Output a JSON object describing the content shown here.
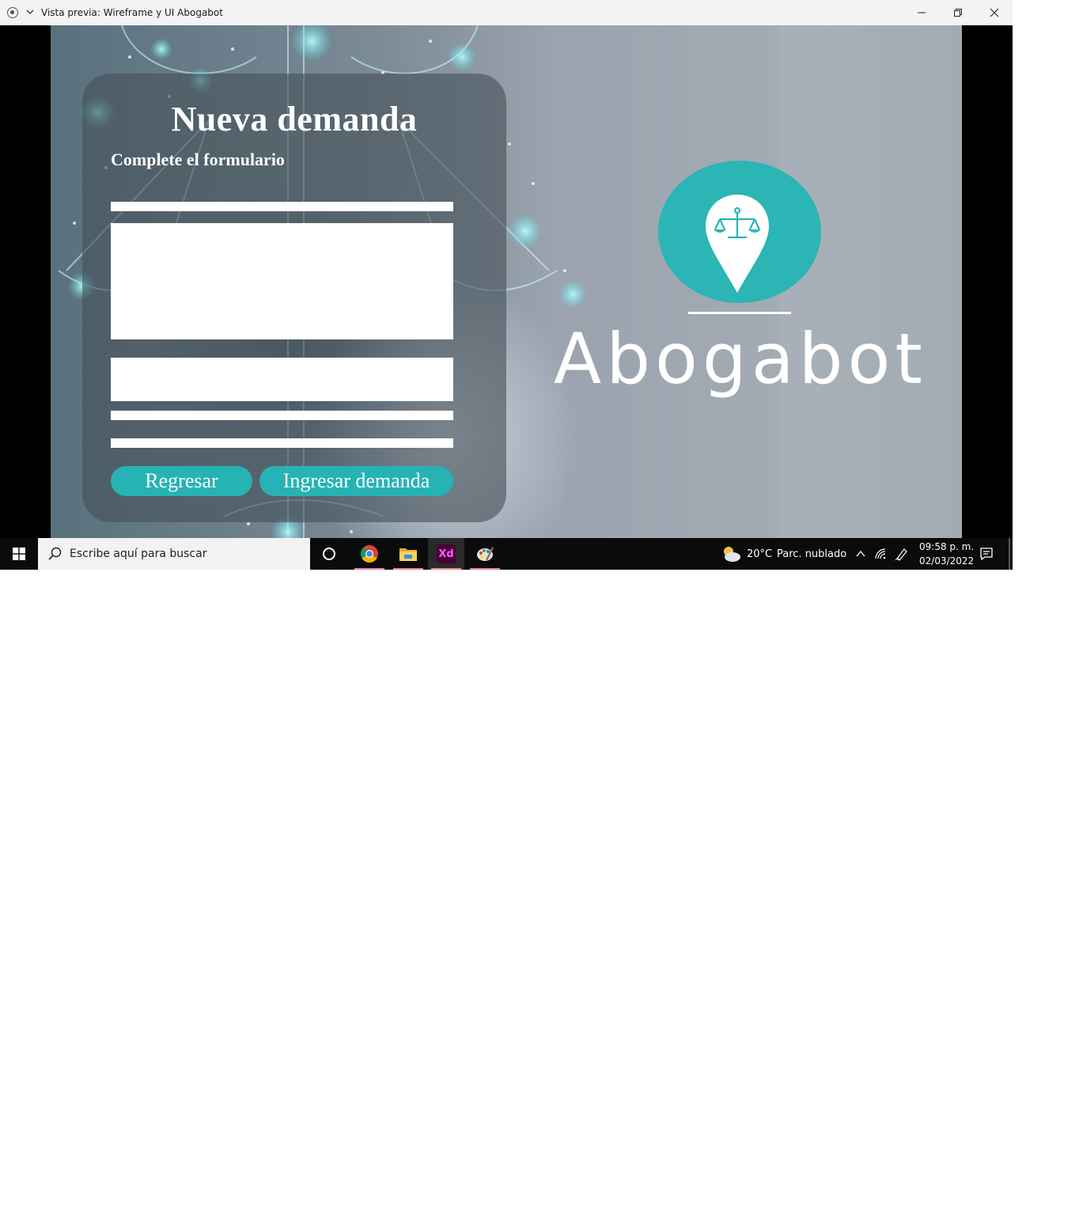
{
  "window": {
    "title": "Vista previa: Wireframe y UI Abogabot"
  },
  "form": {
    "title": "Nueva demanda",
    "subtitle": "Complete el formulario",
    "back_label": "Regresar",
    "submit_label": "Ingresar demanda"
  },
  "logo": {
    "name": "Abogabot",
    "icon": "location-pin-with-scales-icon",
    "color": "#2bb5b5"
  },
  "taskbar": {
    "search_placeholder": "Escribe aquí para buscar",
    "apps": [
      "cortana-icon",
      "chrome-icon",
      "file-explorer-icon",
      "adobe-xd-icon",
      "paint-icon"
    ],
    "xd_label": "Xd",
    "weather_temp": "20°C",
    "weather_desc": "Parc. nublado",
    "time": "09:58 p. m.",
    "date": "02/03/2022"
  },
  "colors": {
    "accent": "#27b3b4",
    "taskbar": "#0b0b0b",
    "titlebar": "#f3f3f3"
  }
}
